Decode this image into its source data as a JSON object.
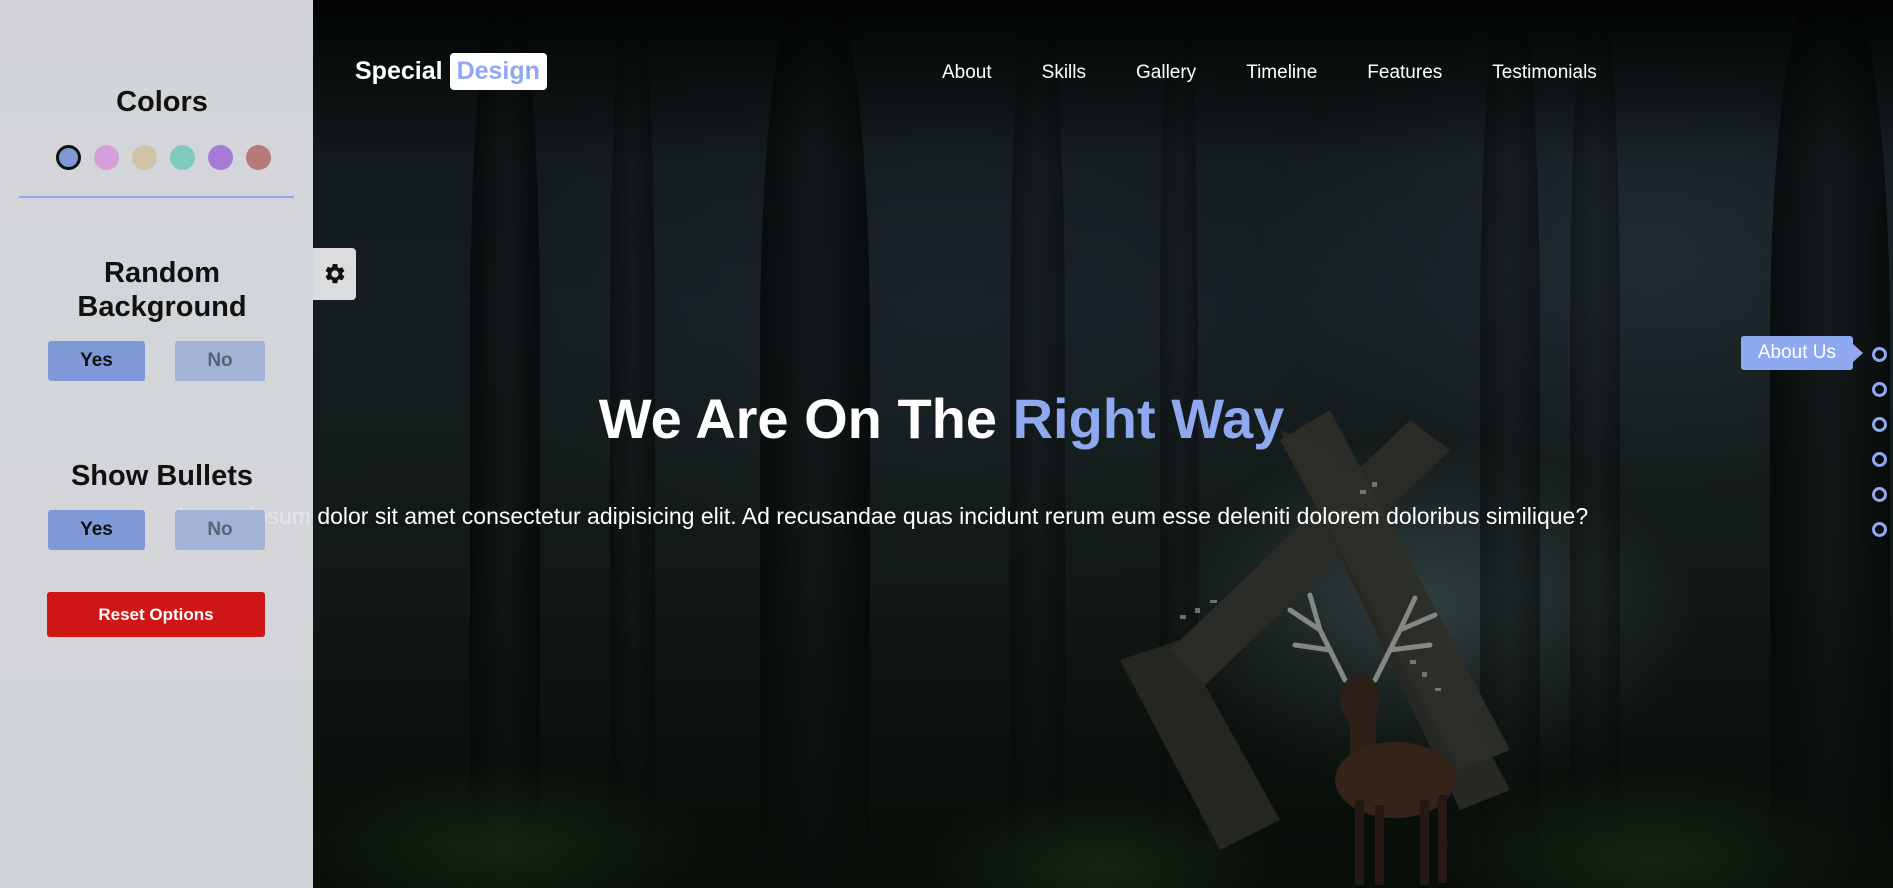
{
  "header": {
    "logo_main": "Special",
    "logo_highlight": "Design",
    "nav": [
      "About",
      "Skills",
      "Gallery",
      "Timeline",
      "Features",
      "Testimonials"
    ]
  },
  "hero": {
    "title_main": "We Are On The ",
    "title_accent": "Right Way",
    "text": "Lorem ipsum dolor sit amet consectetur adipisicing elit. Ad recusandae quas incidunt rerum eum esse deleniti dolorem doloribus similique?"
  },
  "bullets": {
    "tooltip": "About Us",
    "count": 6
  },
  "settings": {
    "colors_title": "Colors",
    "color_swatches": [
      "#7f99d8",
      "#d59fd9",
      "#d2c3a6",
      "#7fcabb",
      "#a77ad8",
      "#b57a7a"
    ],
    "random_bg_title": "Random Background",
    "random_bg_yes": "Yes",
    "random_bg_no": "No",
    "show_bullets_title": "Show Bullets",
    "show_bullets_yes": "Yes",
    "show_bullets_no": "No",
    "reset_label": "Reset Options"
  },
  "theme": {
    "accent": "#8fa9f0",
    "reset": "#d01616"
  }
}
